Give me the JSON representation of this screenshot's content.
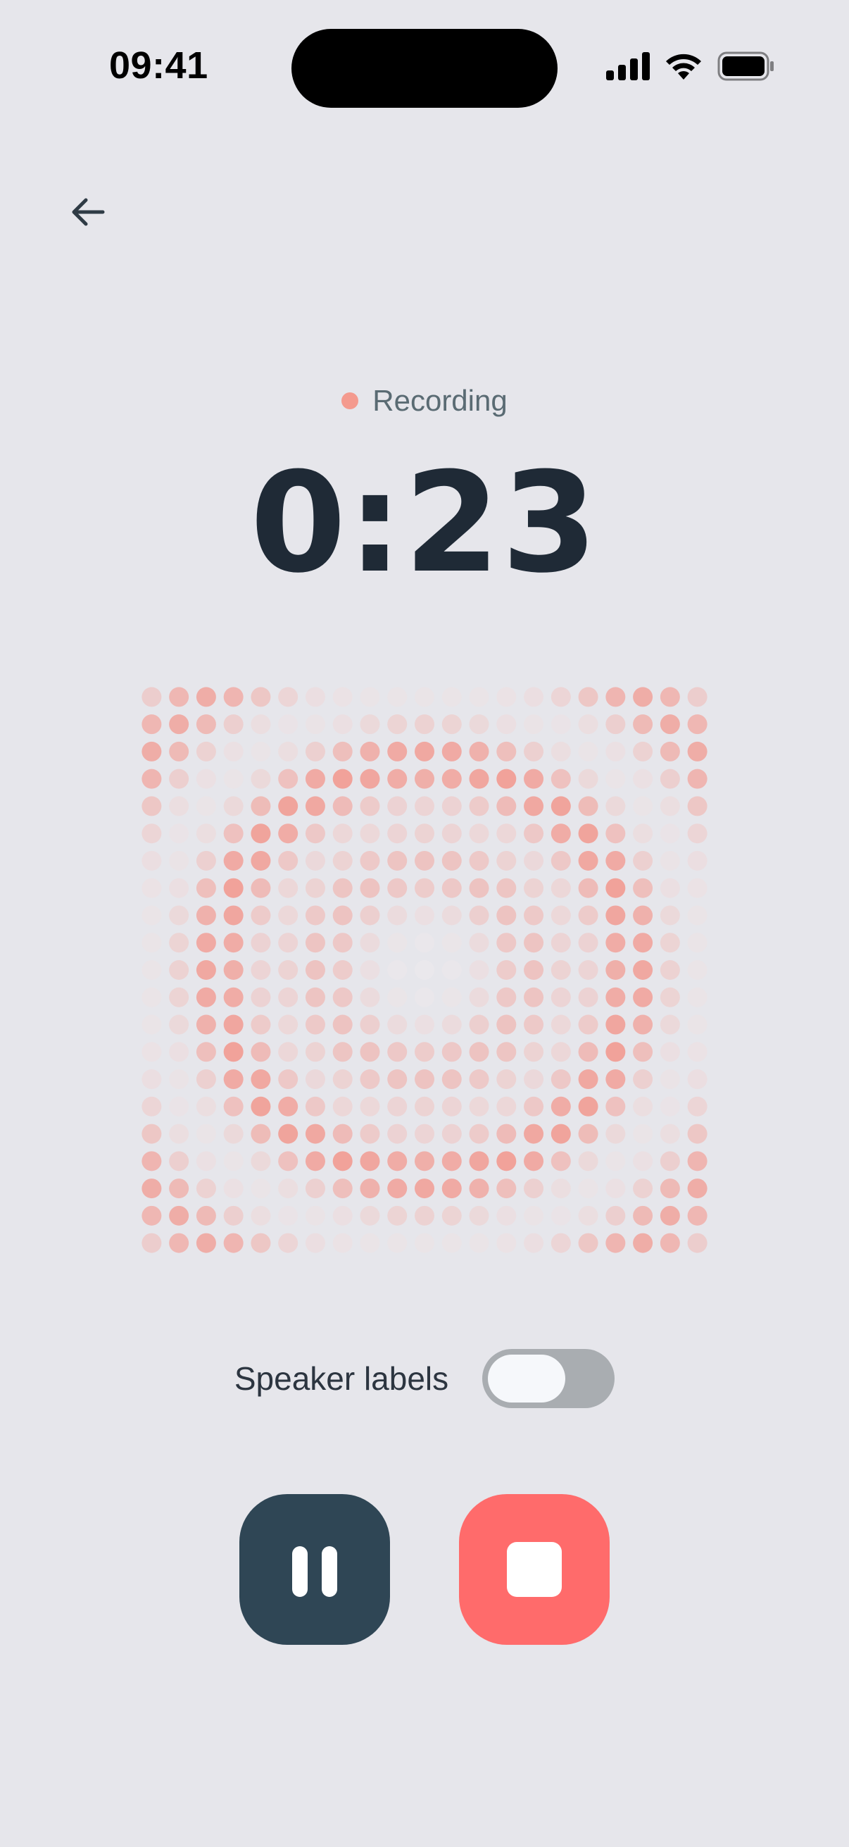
{
  "status_bar": {
    "time": "09:41"
  },
  "nav": {
    "back_icon": "arrow-left-icon"
  },
  "recording": {
    "status_label": "Recording",
    "status_color": "#F49A8E",
    "timer": "0:23"
  },
  "visualizer": {
    "type": "dot-matrix",
    "rows": 21,
    "cols": 21,
    "accent_color": "#F47C6E"
  },
  "speaker_labels": {
    "label": "Speaker labels",
    "enabled": false
  },
  "controls": {
    "pause_icon": "pause-icon",
    "stop_icon": "stop-icon",
    "pause_color": "#2F4655",
    "stop_color": "#FF6B6B"
  }
}
